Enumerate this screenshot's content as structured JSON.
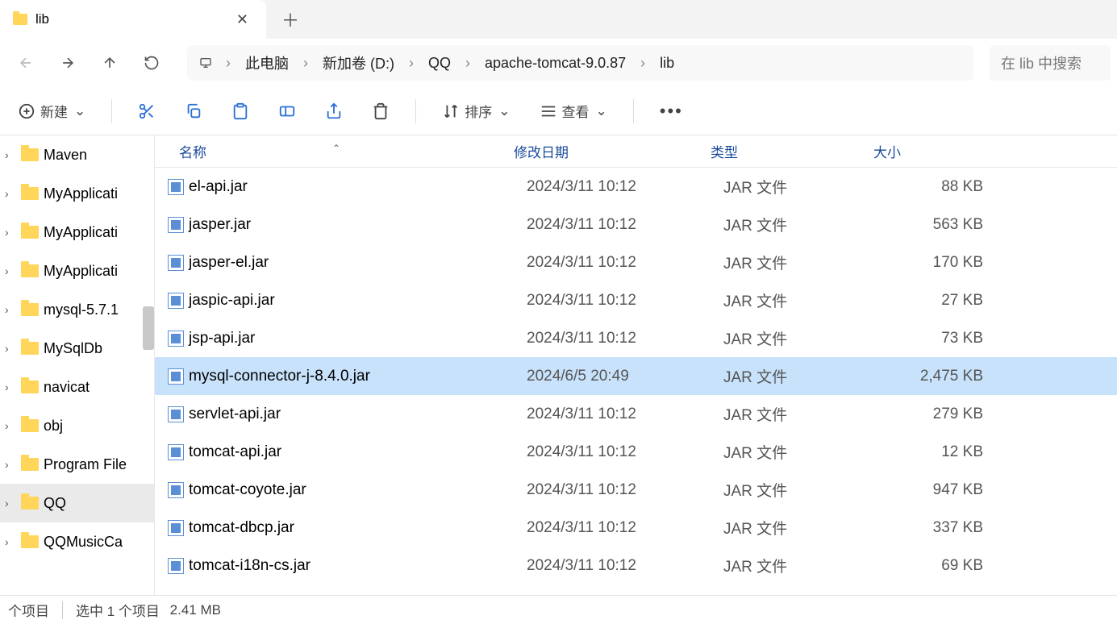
{
  "tab": {
    "title": "lib"
  },
  "breadcrumb": {
    "segments": [
      "此电脑",
      "新加卷 (D:)",
      "QQ",
      "apache-tomcat-9.0.87",
      "lib"
    ]
  },
  "search": {
    "placeholder": "在 lib 中搜索"
  },
  "toolbar": {
    "new": "新建",
    "sort": "排序",
    "view": "查看"
  },
  "columns": {
    "name": "名称",
    "date": "修改日期",
    "type": "类型",
    "size": "大小"
  },
  "sidebar": {
    "items": [
      {
        "label": "Maven",
        "selected": false
      },
      {
        "label": "MyApplicati",
        "selected": false
      },
      {
        "label": "MyApplicati",
        "selected": false
      },
      {
        "label": "MyApplicati",
        "selected": false
      },
      {
        "label": "mysql-5.7.1",
        "selected": false
      },
      {
        "label": "MySqlDb",
        "selected": false
      },
      {
        "label": "navicat",
        "selected": false
      },
      {
        "label": "obj",
        "selected": false
      },
      {
        "label": "Program File",
        "selected": false
      },
      {
        "label": "QQ",
        "selected": true
      },
      {
        "label": "QQMusicCa",
        "selected": false
      }
    ]
  },
  "files": [
    {
      "name": "el-api.jar",
      "date": "2024/3/11 10:12",
      "type": "JAR 文件",
      "size": "88 KB",
      "selected": false
    },
    {
      "name": "jasper.jar",
      "date": "2024/3/11 10:12",
      "type": "JAR 文件",
      "size": "563 KB",
      "selected": false
    },
    {
      "name": "jasper-el.jar",
      "date": "2024/3/11 10:12",
      "type": "JAR 文件",
      "size": "170 KB",
      "selected": false
    },
    {
      "name": "jaspic-api.jar",
      "date": "2024/3/11 10:12",
      "type": "JAR 文件",
      "size": "27 KB",
      "selected": false
    },
    {
      "name": "jsp-api.jar",
      "date": "2024/3/11 10:12",
      "type": "JAR 文件",
      "size": "73 KB",
      "selected": false
    },
    {
      "name": "mysql-connector-j-8.4.0.jar",
      "date": "2024/6/5 20:49",
      "type": "JAR 文件",
      "size": "2,475 KB",
      "selected": true
    },
    {
      "name": "servlet-api.jar",
      "date": "2024/3/11 10:12",
      "type": "JAR 文件",
      "size": "279 KB",
      "selected": false
    },
    {
      "name": "tomcat-api.jar",
      "date": "2024/3/11 10:12",
      "type": "JAR 文件",
      "size": "12 KB",
      "selected": false
    },
    {
      "name": "tomcat-coyote.jar",
      "date": "2024/3/11 10:12",
      "type": "JAR 文件",
      "size": "947 KB",
      "selected": false
    },
    {
      "name": "tomcat-dbcp.jar",
      "date": "2024/3/11 10:12",
      "type": "JAR 文件",
      "size": "337 KB",
      "selected": false
    },
    {
      "name": "tomcat-i18n-cs.jar",
      "date": "2024/3/11 10:12",
      "type": "JAR 文件",
      "size": "69 KB",
      "selected": false
    }
  ],
  "status": {
    "items": "个项目",
    "selection": "选中 1 个项目",
    "size": "2.41 MB"
  }
}
